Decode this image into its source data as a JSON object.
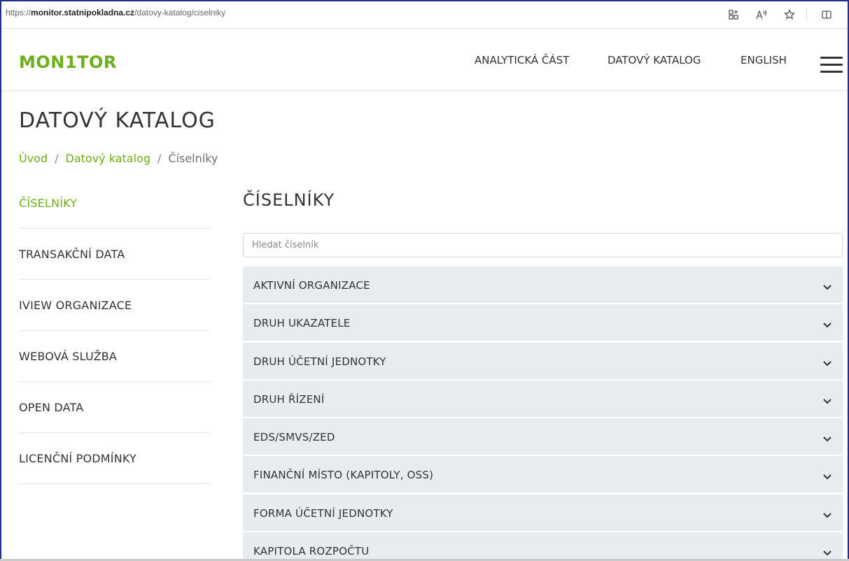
{
  "browser": {
    "url_prefix": "https://",
    "url_host": "monitor.statnipokladna.cz",
    "url_path": "/datovy-katalog/ciselniky",
    "icons": [
      "app-available-icon",
      "read-aloud-icon",
      "favorite-star-icon",
      "split-screen-icon"
    ]
  },
  "header": {
    "logo": "MON1TOR",
    "nav": [
      "ANALYTICKÁ ČÁST",
      "DATOVÝ KATALOG",
      "ENGLISH"
    ]
  },
  "page": {
    "title": "DATOVÝ KATALOG",
    "breadcrumb": [
      "Úvod",
      "Datový katalog",
      "Číselníky"
    ],
    "breadcrumb_separator": "/"
  },
  "sidebar": {
    "items": [
      {
        "label": "ČÍSELNÍKY",
        "active": true
      },
      {
        "label": "TRANSAKČNÍ DATA",
        "active": false
      },
      {
        "label": "IVIEW ORGANIZACE",
        "active": false
      },
      {
        "label": "WEBOVÁ SLUŽBA",
        "active": false
      },
      {
        "label": "OPEN DATA",
        "active": false
      },
      {
        "label": "LICENČNÍ PODMÍNKY",
        "active": false
      }
    ]
  },
  "main": {
    "section_title": "ČÍSELNÍKY",
    "search": {
      "placeholder": "Hledat číselník",
      "value": ""
    },
    "accordion": [
      "AKTIVNÍ ORGANIZACE",
      "DRUH UKAZATELE",
      "DRUH ÚČETNÍ JEDNOTKY",
      "DRUH ŘÍZENÍ",
      "EDS/SMVS/ZED",
      "FINANČNÍ MÍSTO (KAPITOLY, OSS)",
      "FORMA ÚČETNÍ JEDNOTKY",
      "KAPITOLA ROZPOČTU"
    ]
  },
  "colors": {
    "accent": "#6dae1c",
    "accordion_bg": "#e9ecef",
    "text": "#333333",
    "frame": "#1f2f8a"
  }
}
